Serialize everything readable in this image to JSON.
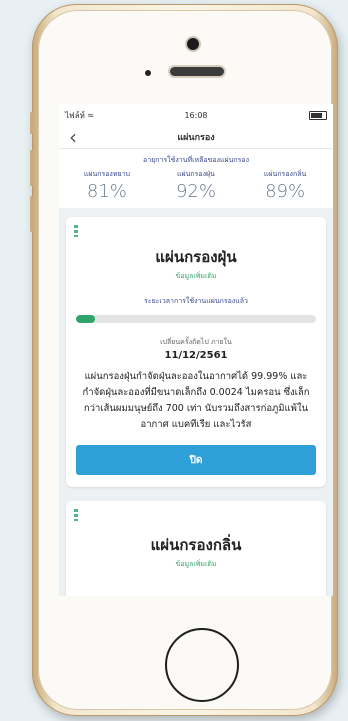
{
  "status_bar": {
    "carrier": "ไฟล์ห์ ≈",
    "time": "16:08",
    "battery_icon": "battery-icon"
  },
  "nav": {
    "title": "แผ่นกรอง",
    "back_icon": "chevron-left-icon"
  },
  "summary": {
    "heading": "อายุการใช้งานที่เหลือของแผ่นกรอง",
    "stats": [
      {
        "label": "แผ่นกรองหยาบ",
        "value": "81%"
      },
      {
        "label": "แผ่นกรองฝุ่น",
        "value": "92%"
      },
      {
        "label": "แผ่นกรองกลิ่น",
        "value": "89%"
      }
    ]
  },
  "filter_card": {
    "title": "แผ่นกรองฝุ่น",
    "subtitle": "ข้อมูลเพิ่มเติม",
    "usage_label": "ระยะเวลาการใช้งานแผ่นกรองแล้ว",
    "usage_progress": 0.08,
    "expire_label": "เปลี่ยนครั้งถัดไป ภายใน",
    "expire_date": "11/12/2561",
    "description": "แผ่นกรองฝุ่นกำจัดฝุ่นละอองในอากาศได้ 99.99% และกำจัดฝุ่นละอองที่มีขนาดเล็กถึง 0.0024 ไมครอน ซึ่งเล็กกว่าเส้นผมมนุษย์ถึง 700 เท่า นับรวมถึงสารก่อภูมิแพ้ในอากาศ แบคทีเรีย และไวรัส",
    "button_label": "ปิด"
  },
  "filter_card_2": {
    "title": "แผ่นกรองกลิ่น",
    "subtitle": "ข้อมูลเพิ่มเติม"
  },
  "colors": {
    "accent": "#2f9fd8",
    "green": "#2ea46a",
    "label_blue": "#3b4a8a"
  }
}
